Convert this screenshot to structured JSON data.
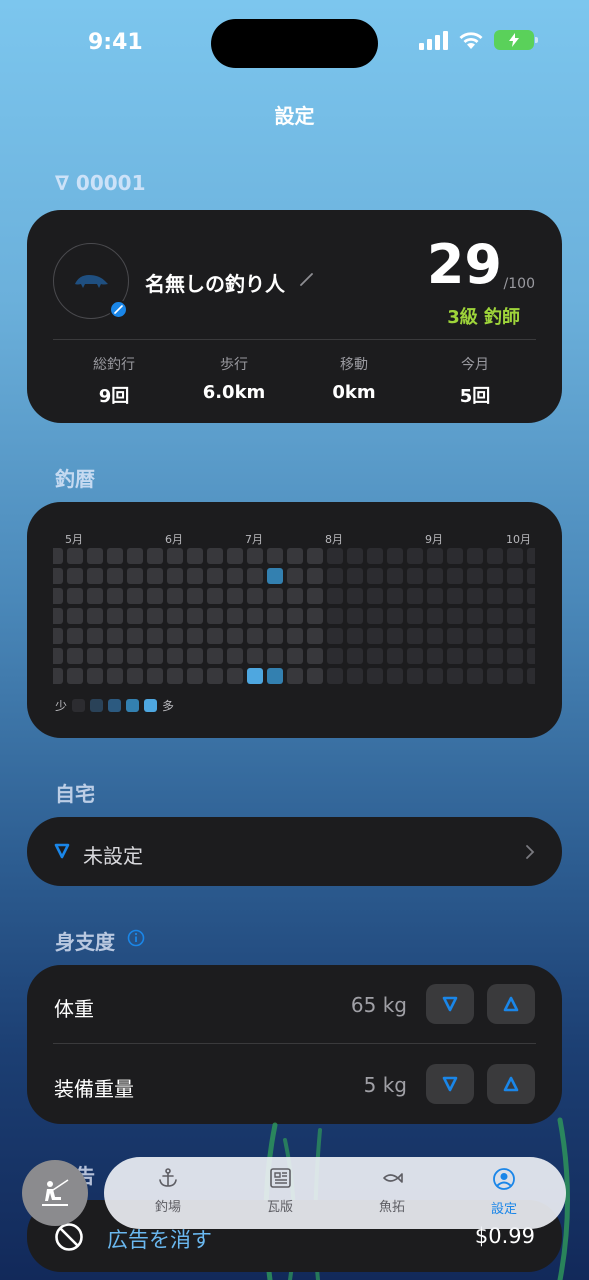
{
  "status": {
    "time": "9:41"
  },
  "header": {
    "title": "設定"
  },
  "user_id": "∇ 00001",
  "profile": {
    "name": "名無しの釣り人",
    "level": "29",
    "level_max": "/100",
    "rank": "3級 釣師",
    "stats": [
      {
        "label": "総釣行",
        "value": "9回"
      },
      {
        "label": "歩行",
        "value": "6.0km"
      },
      {
        "label": "移動",
        "value": "0km"
      },
      {
        "label": "今月",
        "value": "5回"
      }
    ]
  },
  "history": {
    "label": "釣暦",
    "months": [
      "5月",
      "6月",
      "7月",
      "8月",
      "9月",
      "10月"
    ],
    "legend_less": "少",
    "legend_more": "多",
    "scale_colors": [
      "#2c2c30",
      "#2a4258",
      "#2c5a80",
      "#3380b0",
      "#4ea7e0"
    ],
    "empty_color": "#2c2c30",
    "past_color": "#38383c",
    "filled_cells": [
      {
        "week": 11,
        "day": 1,
        "level": 3
      },
      {
        "week": 10,
        "day": 6,
        "level": 4
      },
      {
        "week": 11,
        "day": 6,
        "level": 3
      }
    ]
  },
  "home": {
    "label": "自宅",
    "value": "未設定"
  },
  "body": {
    "label": "身支度",
    "weight_label": "体重",
    "weight_value": "65 kg",
    "gear_label": "装備重量",
    "gear_value": "5 kg"
  },
  "ads": {
    "section_label": "広告",
    "remove_label": "広告を消す",
    "price": "$0.99"
  },
  "tabs": [
    {
      "label": "釣場",
      "icon": "anchor-icon"
    },
    {
      "label": "瓦版",
      "icon": "newspaper-icon"
    },
    {
      "label": "魚拓",
      "icon": "fish-icon"
    },
    {
      "label": "設定",
      "icon": "person-circle-icon"
    }
  ],
  "colors": {
    "accent": "#1a86e8",
    "rank": "#9ed43a",
    "card": "#1c1c1e"
  }
}
